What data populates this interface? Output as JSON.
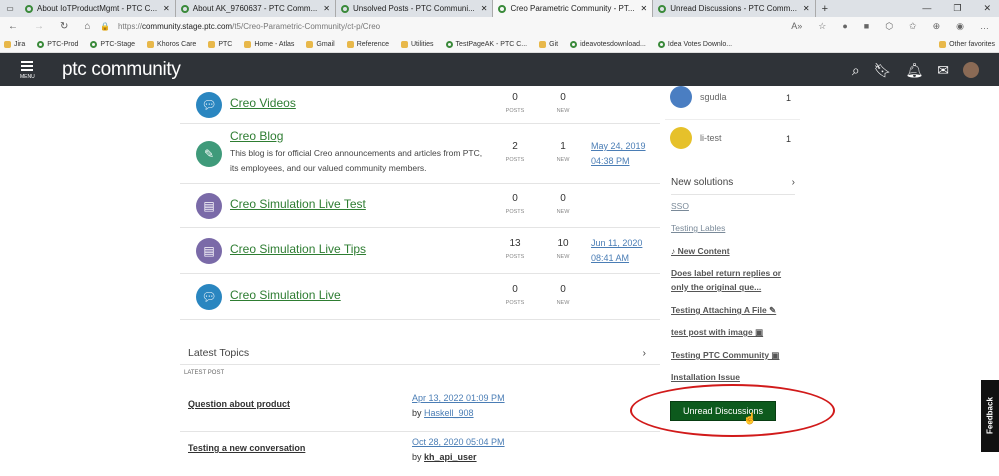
{
  "browser": {
    "tabs": [
      {
        "label": "About IoTProductMgmt - PTC C..."
      },
      {
        "label": "About AK_9760637 - PTC Comm..."
      },
      {
        "label": "Unsolved Posts - PTC Communi..."
      },
      {
        "label": "Creo Parametric Community - PT..."
      },
      {
        "label": "Unread Discussions - PTC Comm..."
      }
    ],
    "active_tab": 3,
    "url_prefix": "https://",
    "url_host": "community.stage.ptc.com",
    "url_path": "/t5/Creo-Parametric-Community/ct-p/Creo",
    "bookmarks": [
      "Jira",
      "PTC-Prod",
      "PTC-Stage",
      "Khoros Care",
      "PTC",
      "Home - Atlas",
      "Gmail",
      "Reference",
      "Utilities",
      "TestPageAK - PTC C...",
      "Git",
      "ideavotesdownload...",
      "Idea Votes Downlo..."
    ],
    "other_favorites": "Other favorites"
  },
  "header": {
    "menu_label": "MENU",
    "logo": "ptc community",
    "logo_mark": "®"
  },
  "boards": [
    {
      "title": "Creo Videos",
      "desc": "",
      "posts": "0",
      "new": "0",
      "date": "",
      "time": "",
      "icon": "chat-icon",
      "color": "#2a86c0"
    },
    {
      "title": "Creo Blog",
      "desc": "This blog is for official Creo announcements and articles from PTC, its employees, and our valued community members.",
      "posts": "2",
      "new": "1",
      "date": "May 24, 2019",
      "time": "04:38 PM",
      "icon": "pencil-icon",
      "color": "#3f9a7a"
    },
    {
      "title": "Creo Simulation Live Test",
      "desc": "",
      "posts": "0",
      "new": "0",
      "date": "",
      "time": "",
      "icon": "book-icon",
      "color": "#7a6aa8"
    },
    {
      "title": "Creo Simulation Live Tips",
      "desc": "",
      "posts": "13",
      "new": "10",
      "date": "Jun 11, 2020",
      "time": "08:41 AM",
      "icon": "book-icon",
      "color": "#7a6aa8"
    },
    {
      "title": "Creo Simulation Live",
      "desc": "",
      "posts": "0",
      "new": "0",
      "date": "",
      "time": "",
      "icon": "chat-icon",
      "color": "#2a86c0"
    }
  ],
  "labels": {
    "posts": "POSTS",
    "new": "NEW"
  },
  "sidebar": {
    "users": [
      {
        "name": "sgudla",
        "count": "1"
      },
      {
        "name": "li-test",
        "count": "1"
      }
    ],
    "new_solutions_title": "New solutions",
    "solutions": [
      "SSO",
      "Testing Lables",
      "♪ New Content",
      "Does label return replies or only the original que...",
      "Testing Attaching A File ✎",
      "test post with image ▣",
      "Testing PTC Community ▣",
      "Installation Issue"
    ],
    "unread_button": "Unread Discussions"
  },
  "latest": {
    "title": "Latest Topics",
    "col_label": "LATEST POST",
    "by": "by",
    "topics": [
      {
        "title": "Question about product",
        "date": "Apr 13, 2022 01:09 PM",
        "author": "Haskell_908"
      },
      {
        "title": "Testing a new conversation",
        "date": "Oct 28, 2020 05:04 PM",
        "author": "kh_api_user"
      }
    ]
  },
  "feedback": "Feedback"
}
